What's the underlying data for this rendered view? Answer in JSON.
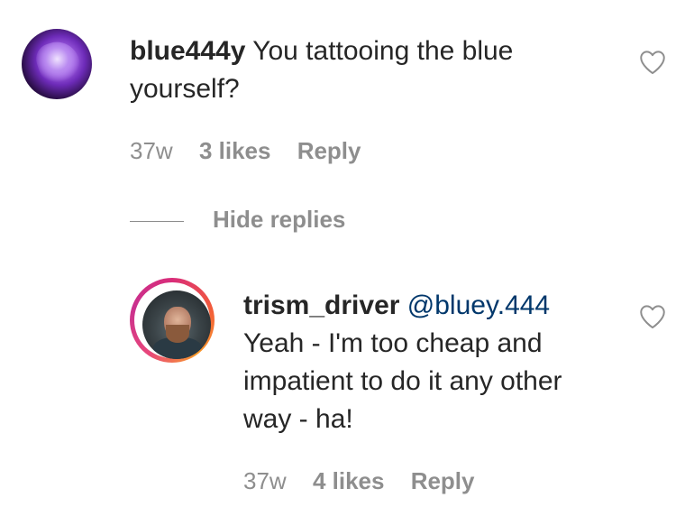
{
  "comment": {
    "username": "blue444y",
    "text": "You tattooing the blue yourself?",
    "time": "37w",
    "likes": "3 likes",
    "reply_label": "Reply"
  },
  "hide_replies_label": "Hide replies",
  "reply": {
    "username": "trism_driver",
    "mention": "@bluey.444",
    "text": "Yeah - I'm too cheap and impatient to do it any other way - ha!",
    "time": "37w",
    "likes": "4 likes",
    "reply_label": "Reply"
  },
  "icons": {
    "like": "heart-outline-icon"
  },
  "colors": {
    "text": "#262626",
    "secondary": "#8e8e8e",
    "mention": "#00376b",
    "story_ring_start": "#d92d7a",
    "story_ring_end": "#f99b2a"
  }
}
